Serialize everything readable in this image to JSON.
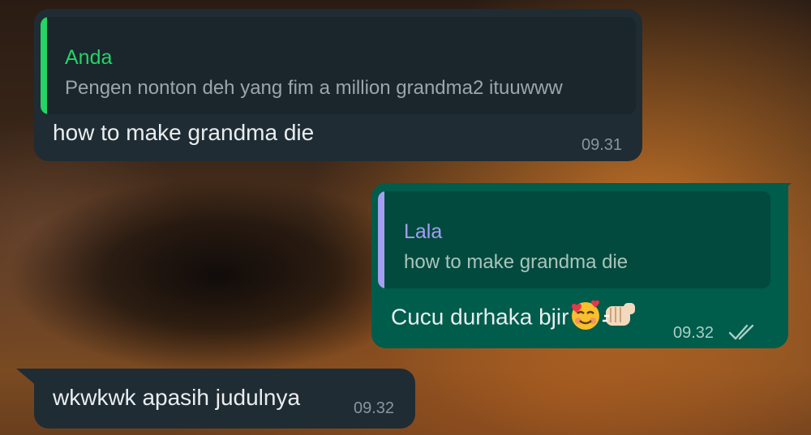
{
  "messages": [
    {
      "direction": "incoming",
      "quote": {
        "author": "Anda",
        "author_color": "#25d366",
        "text": "Pengen nonton deh yang fim a million grandma2 ituuwww"
      },
      "text": "how to make grandma die",
      "time": "09.31"
    },
    {
      "direction": "outgoing",
      "quote": {
        "author": "Lala",
        "author_color": "#a59ef2",
        "text": "how to make grandma die"
      },
      "text": "Cucu durhaka bjir",
      "emojis": [
        "smiling-face-with-hearts-emoji",
        "punch-fist-emoji"
      ],
      "time": "09.32",
      "status": "read-double-check"
    },
    {
      "direction": "incoming",
      "text": "wkwkwk apasih judulnya",
      "time": "09.32"
    }
  ],
  "colors": {
    "incoming_bubble": "#1f2c34",
    "outgoing_bubble": "#005c4b",
    "incoming_quote_bar": "#25d366",
    "outgoing_quote_bar": "#a59ef2"
  }
}
